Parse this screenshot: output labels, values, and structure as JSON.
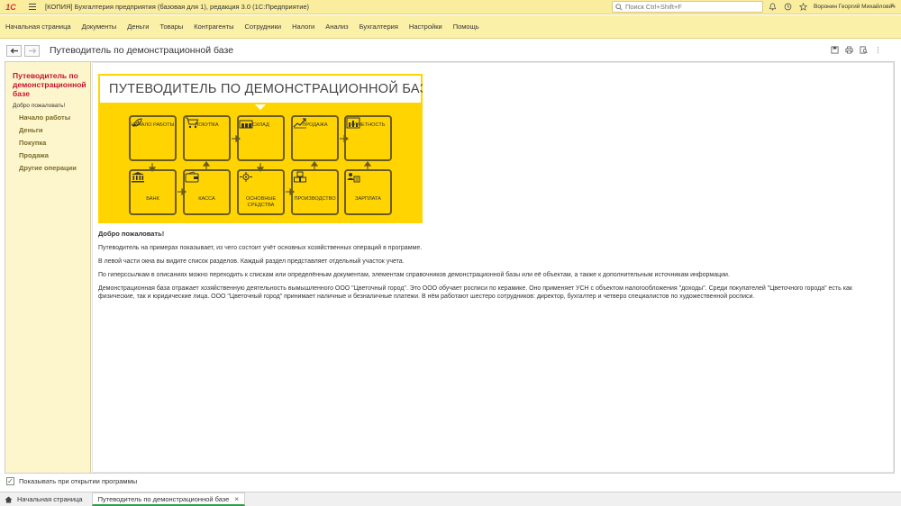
{
  "window": {
    "logo": "1С",
    "title": "[КОПИЯ] Бухгалтерия предприятия (базовая для 1), редакция 3.0  (1С:Предприятие)",
    "search_placeholder": "Поиск Ctrl+Shift+F",
    "user": "Воронин Георгий Михайлович"
  },
  "sections": [
    "Начальная страница",
    "Документы",
    "Деньги",
    "Товары",
    "Контрагенты",
    "Сотрудники",
    "Налоги",
    "Анализ",
    "Бухгалтерия",
    "Настройки",
    "Помощь"
  ],
  "form": {
    "title": "Путеводитель по демонстрационной базе"
  },
  "sidebar": {
    "title": "Путеводитель по демонстрационной базе",
    "welcome": "Добро пожаловать!",
    "items": [
      "Начало работы",
      "Деньги",
      "Покупка",
      "Продажа",
      "Другие операции"
    ]
  },
  "banner": {
    "heading": "ПУТЕВОДИТЕЛЬ ПО ДЕМОНСТРАЦИОННОЙ БАЗЕ",
    "tiles": {
      "start": "НАЧАЛО РАБОТЫ",
      "purchase": "ПОКУПКА",
      "warehouse": "СКЛАД",
      "sale": "ПРОДАЖА",
      "reports": "ОТЧЕТНОСТЬ",
      "bank": "БАНК",
      "cash": "КАССА",
      "assets": "ОСНОВНЫЕ СРЕДСТВА",
      "production": "ПРОИЗВОДСТВО",
      "salary": "ЗАРПЛАТА"
    }
  },
  "content": {
    "heading": "Добро пожаловать!",
    "p1": "Путеводитель на примерах показывает, из чего состоит учёт основных хозяйственных операций в программе.",
    "p2": "В левой части окна вы видите список разделов. Каждый раздел представляет отдельный участок учета.",
    "p3": "По гиперссылкам в описаниях можно переходить к спискам или определённым документам, элементам справочников демонстрационной базы или её объектам, а также к дополнительным источникам информации.",
    "p4": "Демонстрационная база отражает хозяйственную деятельность вымышленного ООО \"Цветочный город\". Это ООО обучает росписи по керамике. Оно применяет УСН с объектом налогообложения \"доходы\". Среди покупателей \"Цветочного города\" есть как физические, так и юридические лица. ООО \"Цветочный город\" принимает наличные и безналичные платежи. В нём работают шестеро сотрудников: директор, бухгалтер и четверо специалистов по художественной росписи."
  },
  "footer": {
    "show_on_open": "Показывать при открытии программы",
    "checked": true
  },
  "tabs": [
    "Начальная страница",
    "Путеводитель по демонстрационной базе"
  ]
}
